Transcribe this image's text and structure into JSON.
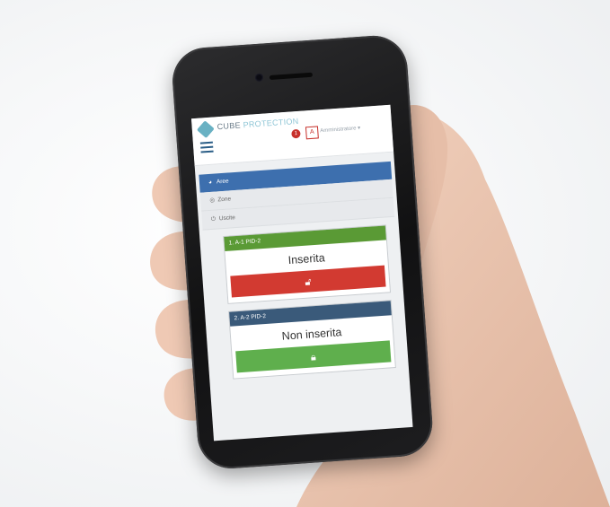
{
  "app": {
    "logo_main": "CUBE",
    "logo_accent": "PROTECTION",
    "alert_count": "1",
    "user_initial": "A",
    "user_name": "Amministratore ▾"
  },
  "nav": {
    "items": [
      {
        "label": "Aree",
        "icon": "globe-icon",
        "active": true
      },
      {
        "label": "Zone",
        "icon": "target-icon",
        "active": false
      },
      {
        "label": "Uscite",
        "icon": "power-icon",
        "active": false
      }
    ]
  },
  "areas": [
    {
      "title": "1. A-1 PID-2",
      "state": "Inserita",
      "button_icon": "unlock-icon",
      "header_color": "#5a9a35",
      "button_color": "#d23a31"
    },
    {
      "title": "2. A-2 PID-2",
      "state": "Non inserita",
      "button_icon": "lock-icon",
      "header_color": "#3a5a7a",
      "button_color": "#5faf4d"
    }
  ]
}
